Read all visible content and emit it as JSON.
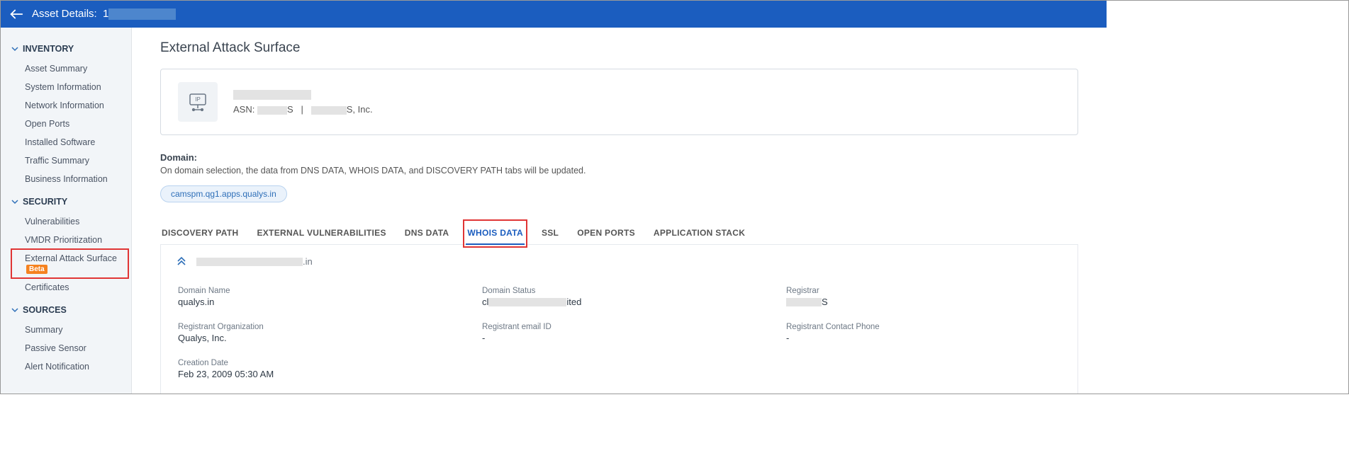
{
  "header": {
    "title_prefix": "Asset Details:",
    "asset_id_visible": "1"
  },
  "sidebar": {
    "groups": [
      {
        "id": "inventory",
        "label": "INVENTORY",
        "items": [
          {
            "label": "Asset Summary"
          },
          {
            "label": "System Information"
          },
          {
            "label": "Network Information"
          },
          {
            "label": "Open Ports"
          },
          {
            "label": "Installed Software"
          },
          {
            "label": "Traffic Summary"
          },
          {
            "label": "Business Information"
          }
        ]
      },
      {
        "id": "security",
        "label": "SECURITY",
        "items": [
          {
            "label": "Vulnerabilities"
          },
          {
            "label": "VMDR Prioritization"
          },
          {
            "label": "External Attack Surface",
            "badge": "Beta",
            "highlight": true
          },
          {
            "label": "Certificates"
          }
        ]
      },
      {
        "id": "sources",
        "label": "SOURCES",
        "items": [
          {
            "label": "Summary"
          },
          {
            "label": "Passive Sensor"
          },
          {
            "label": "Alert Notification"
          }
        ]
      }
    ]
  },
  "page": {
    "title": "External Attack Surface",
    "summary": {
      "asn_prefix": "ASN:",
      "asn_suffix": "S",
      "org_suffix": "S, Inc.",
      "separator": "|"
    },
    "domain_section": {
      "label": "Domain:",
      "description": "On domain selection, the data from DNS DATA, WHOIS DATA, and DISCOVERY PATH tabs will be updated.",
      "chip": "camspm.qg1.apps.qualys.in"
    },
    "tabs": [
      {
        "label": "DISCOVERY PATH"
      },
      {
        "label": "EXTERNAL VULNERABILITIES"
      },
      {
        "label": "DNS DATA"
      },
      {
        "label": "WHOIS DATA",
        "active": true,
        "highlight": true
      },
      {
        "label": "SSL"
      },
      {
        "label": "OPEN PORTS"
      },
      {
        "label": "APPLICATION STACK"
      }
    ],
    "whois": {
      "collapsed_domain_suffix": ".in",
      "fields": {
        "domain_name": {
          "label": "Domain Name",
          "value": "qualys.in"
        },
        "domain_status": {
          "label": "Domain Status",
          "value_prefix": "cl",
          "value_suffix": "ited"
        },
        "registrar": {
          "label": "Registrar",
          "value_suffix": "S"
        },
        "registrant_org": {
          "label": "Registrant Organization",
          "value": "Qualys, Inc."
        },
        "registrant_email": {
          "label": "Registrant email ID",
          "value": "-"
        },
        "registrant_phone": {
          "label": "Registrant Contact Phone",
          "value": "-"
        },
        "creation_date": {
          "label": "Creation Date",
          "value": "Feb 23, 2009 05:30 AM"
        }
      }
    }
  }
}
